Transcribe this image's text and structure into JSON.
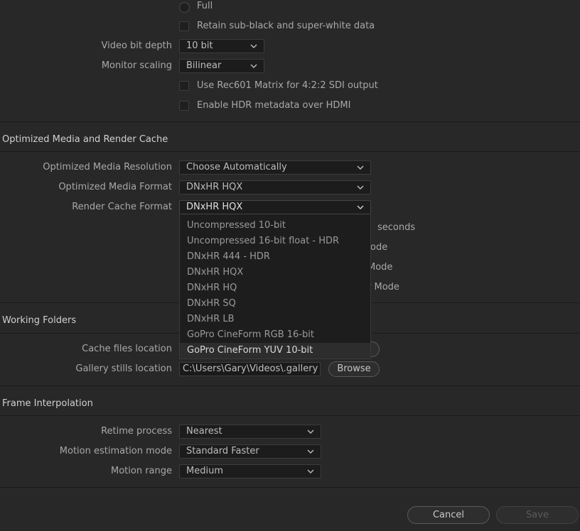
{
  "top": {
    "full_radio_label": "Full",
    "retain_label": "Retain sub-black and super-white data",
    "video_bit_depth_label": "Video bit depth",
    "video_bit_depth_value": "10 bit",
    "monitor_scaling_label": "Monitor scaling",
    "monitor_scaling_value": "Bilinear",
    "rec601_label": "Use Rec601 Matrix for 4:2:2 SDI output",
    "hdr_metadata_label": "Enable HDR metadata over HDMI"
  },
  "optimized": {
    "section_title": "Optimized Media and Render Cache",
    "resolution_label": "Optimized Media Resolution",
    "resolution_value": "Choose Automatically",
    "format_label": "Optimized Media Format",
    "format_value": "DNxHR HQX",
    "render_cache_label": "Render Cache Format",
    "render_cache_value": "DNxHR HQX",
    "seconds_text": "seconds",
    "mode_text_1": "ode",
    "mode_text_2": "Mode",
    "mode_text_3": "r Mode"
  },
  "render_cache_options": [
    "Uncompressed 10-bit",
    "Uncompressed 16-bit float - HDR",
    "DNxHR 444 - HDR",
    "DNxHR HQX",
    "DNxHR HQ",
    "DNxHR SQ",
    "DNxHR LB",
    "GoPro CineForm RGB 16-bit",
    "GoPro CineForm YUV 10-bit"
  ],
  "working_folders": {
    "section_title": "Working Folders",
    "cache_label": "Cache files location",
    "gallery_label": "Gallery stills location",
    "gallery_value": "C:\\Users\\Gary\\Videos\\.gallery",
    "browse_label": "Browse"
  },
  "frame_interpolation": {
    "section_title": "Frame Interpolation",
    "retime_label": "Retime process",
    "retime_value": "Nearest",
    "motion_est_label": "Motion estimation mode",
    "motion_est_value": "Standard Faster",
    "motion_range_label": "Motion range",
    "motion_range_value": "Medium"
  },
  "footer": {
    "cancel_label": "Cancel",
    "save_label": "Save"
  }
}
